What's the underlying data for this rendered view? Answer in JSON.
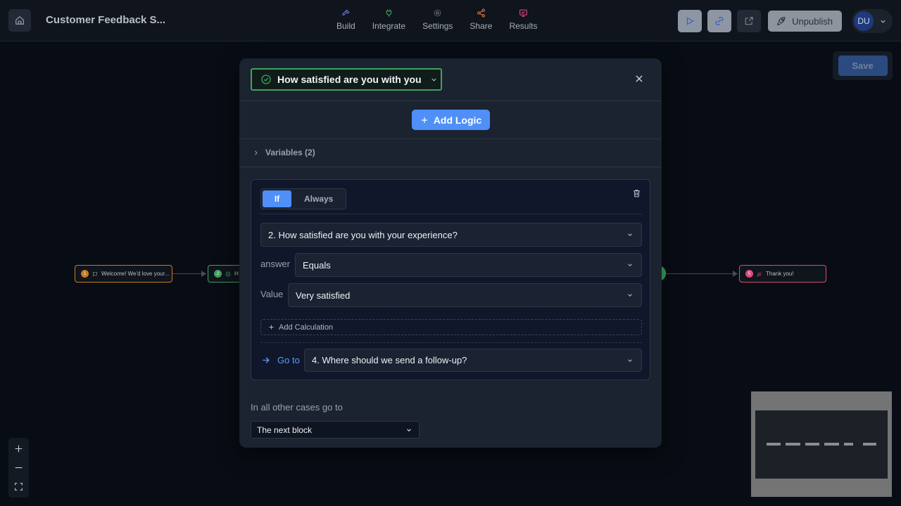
{
  "header": {
    "app_title": "Customer Feedback S...",
    "nav": [
      {
        "label": "Build",
        "icon": "hammer-icon",
        "color": "#6b74d6"
      },
      {
        "label": "Integrate",
        "icon": "plug-icon",
        "color": "#3ea35f"
      },
      {
        "label": "Settings",
        "icon": "gear-icon",
        "color": "#7c8390"
      },
      {
        "label": "Share",
        "icon": "share-icon",
        "color": "#e07b3c"
      },
      {
        "label": "Results",
        "icon": "results-icon",
        "color": "#d94a7d"
      }
    ],
    "unpublish_label": "Unpublish",
    "avatar_initials": "DU"
  },
  "save_label": "Save",
  "canvas": {
    "nodes": [
      {
        "number": "1",
        "label": "Welcome! We'd love your...",
        "color": "#c97a1e"
      },
      {
        "number": "2",
        "label": "H",
        "color": "#3ea35f"
      },
      {
        "number": "5",
        "label": "Thank you!",
        "color": "#d94a7d"
      }
    ]
  },
  "modal": {
    "block_title": "How satisfied are you with you",
    "add_logic_label": "Add Logic",
    "variables_label": "Variables (2)",
    "condition": {
      "tab_if": "If",
      "tab_always": "Always",
      "question": "2. How satisfied are you with your experience?",
      "answer_label": "answer",
      "operator": "Equals",
      "value_label": "Value",
      "value": "Very satisfied",
      "add_calculation_label": "Add Calculation",
      "goto_label": "Go to",
      "goto_target": "4. Where should we send a follow-up?"
    },
    "other_cases_label": "In all other cases go to",
    "other_cases_value": "The next block"
  },
  "colors": {
    "accent": "#4f8ff7",
    "success": "#3ea35f",
    "background": "#080c14",
    "modal": "#1b2330"
  }
}
